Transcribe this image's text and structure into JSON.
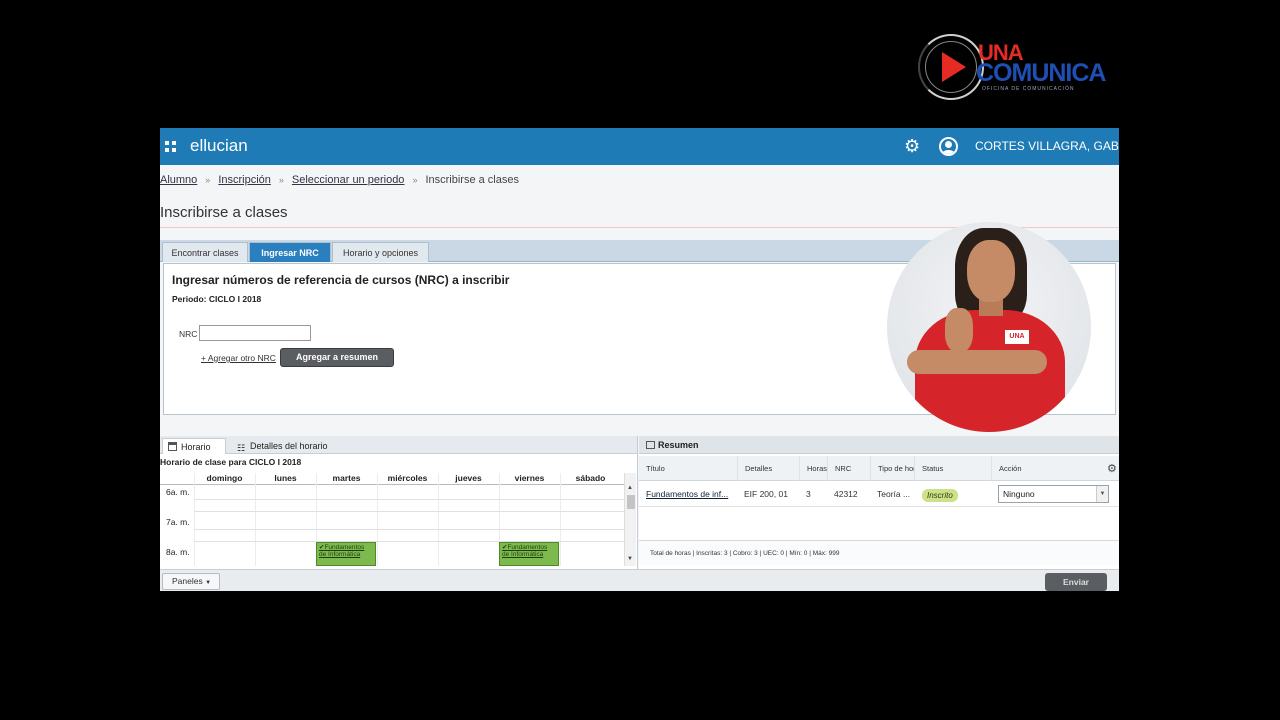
{
  "logo": {
    "line1": "UNA",
    "line2": "COMUNICA",
    "tagline": "OFICINA DE COMUNICACIÓN"
  },
  "header": {
    "brand": "ellucian",
    "user": "CORTES VILLAGRA, GABRIEL"
  },
  "breadcrumb": {
    "items": [
      "Alumno",
      "Inscripción",
      "Seleccionar un periodo"
    ],
    "current": "Inscribirse a clases",
    "separator": "»"
  },
  "page": {
    "title": "Inscribirse a clases"
  },
  "tabs": [
    "Encontrar clases",
    "Ingresar NRC",
    "Horario y opciones"
  ],
  "nrc_panel": {
    "heading": "Ingresar números de referencia de cursos (NRC) a inscribir",
    "periodo": "Periodo: CICLO I 2018",
    "nrc_label": "NRC",
    "nrc_value": "",
    "add_link": "+ Agregar otro NRC",
    "add_button": "Agregar a resumen"
  },
  "horario": {
    "tab_schedule": "Horario",
    "tab_details": "Detalles del horario",
    "caption": "Horario de clase para CICLO I 2018",
    "days": [
      "domingo",
      "lunes",
      "martes",
      "miércoles",
      "jueves",
      "viernes",
      "sábado"
    ],
    "hours": [
      "6a. m.",
      "7a. m.",
      "8a. m."
    ],
    "course_block": "Fundamentos de Informática"
  },
  "resumen": {
    "title": "Resumen",
    "columns": [
      "Título",
      "Detalles",
      "Horas",
      "NRC",
      "Tipo de hor",
      "Status",
      "Acción"
    ],
    "rows": [
      {
        "titulo": "Fundamentos de inf...",
        "detalles": "EIF 200, 01",
        "horas": "3",
        "nrc": "42312",
        "tipo": "Teoría ...",
        "status": "Inscrito",
        "accion": "Ninguno"
      }
    ],
    "totals": "Total de horas | Inscritas: 3 | Cobro: 3 | UEC: 0 | Mín: 0 | Máx: 999"
  },
  "footer": {
    "panels": "Paneles",
    "submit": "Enviar"
  },
  "colors": {
    "topbar": "#1e7bb5",
    "active_tab": "#2a7fbe",
    "course": "#7dba4e",
    "status": "#cde08a"
  }
}
